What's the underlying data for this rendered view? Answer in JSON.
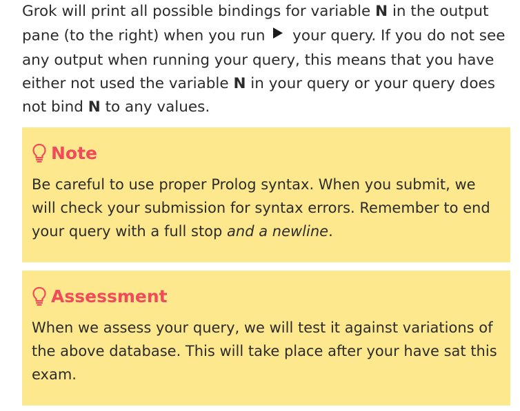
{
  "intro": {
    "part1": "Grok will print all possible bindings for variable ",
    "var1": "N",
    "part2": " in the output pane (to the right) when you run ",
    "play_icon": "play-triangle-icon",
    "part3": " your query. If you do not see any output when running your query, this means that you have either not used the variable ",
    "var2": "N",
    "part4": " in your query or your query does not bind ",
    "var3": "N",
    "part5": " to any values."
  },
  "note": {
    "icon": "lightbulb-icon",
    "title": "Note",
    "body_text": "Be careful to use proper Prolog syntax. When you submit, we will check your submission for syntax errors. Remember to end your query with a full stop ",
    "body_emphasis": "and a newline",
    "body_end": "."
  },
  "assessment": {
    "icon": "lightbulb-icon",
    "title": "Assessment",
    "body": "When we assess your query, we will test it against variations of the above database. This will take place after your have sat this exam."
  },
  "colors": {
    "callout_background": "#fde88d",
    "callout_title": "#f04b5a",
    "text": "#2b2b2b"
  }
}
